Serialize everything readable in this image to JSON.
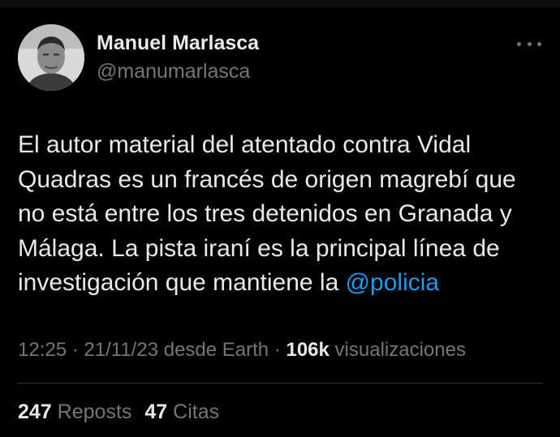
{
  "author": {
    "display_name": "Manuel Marlasca",
    "handle": "@manumarlasca"
  },
  "tweet": {
    "text_before_mention": "El autor material del atentado contra Vidal Quadras es un francés de origen magrebí que no está entre los tres detenidos en Granada y Málaga. La pista iraní es la principal línea de investigación que mantiene la ",
    "mention": "@policia"
  },
  "meta": {
    "time": "12:25",
    "date": "21/11/23",
    "source": "desde Earth",
    "separator": "·",
    "views_count": "106k",
    "views_label": "visualizaciones"
  },
  "stats": {
    "reposts_count": "247",
    "reposts_label": "Reposts",
    "quotes_count": "47",
    "quotes_label": "Citas"
  },
  "icons": {
    "more": "more-horizontal-icon"
  },
  "colors": {
    "background": "#000000",
    "text": "#e7e9ea",
    "secondary": "#71767b",
    "accent": "#1d9bf0",
    "divider": "#2f3336"
  }
}
